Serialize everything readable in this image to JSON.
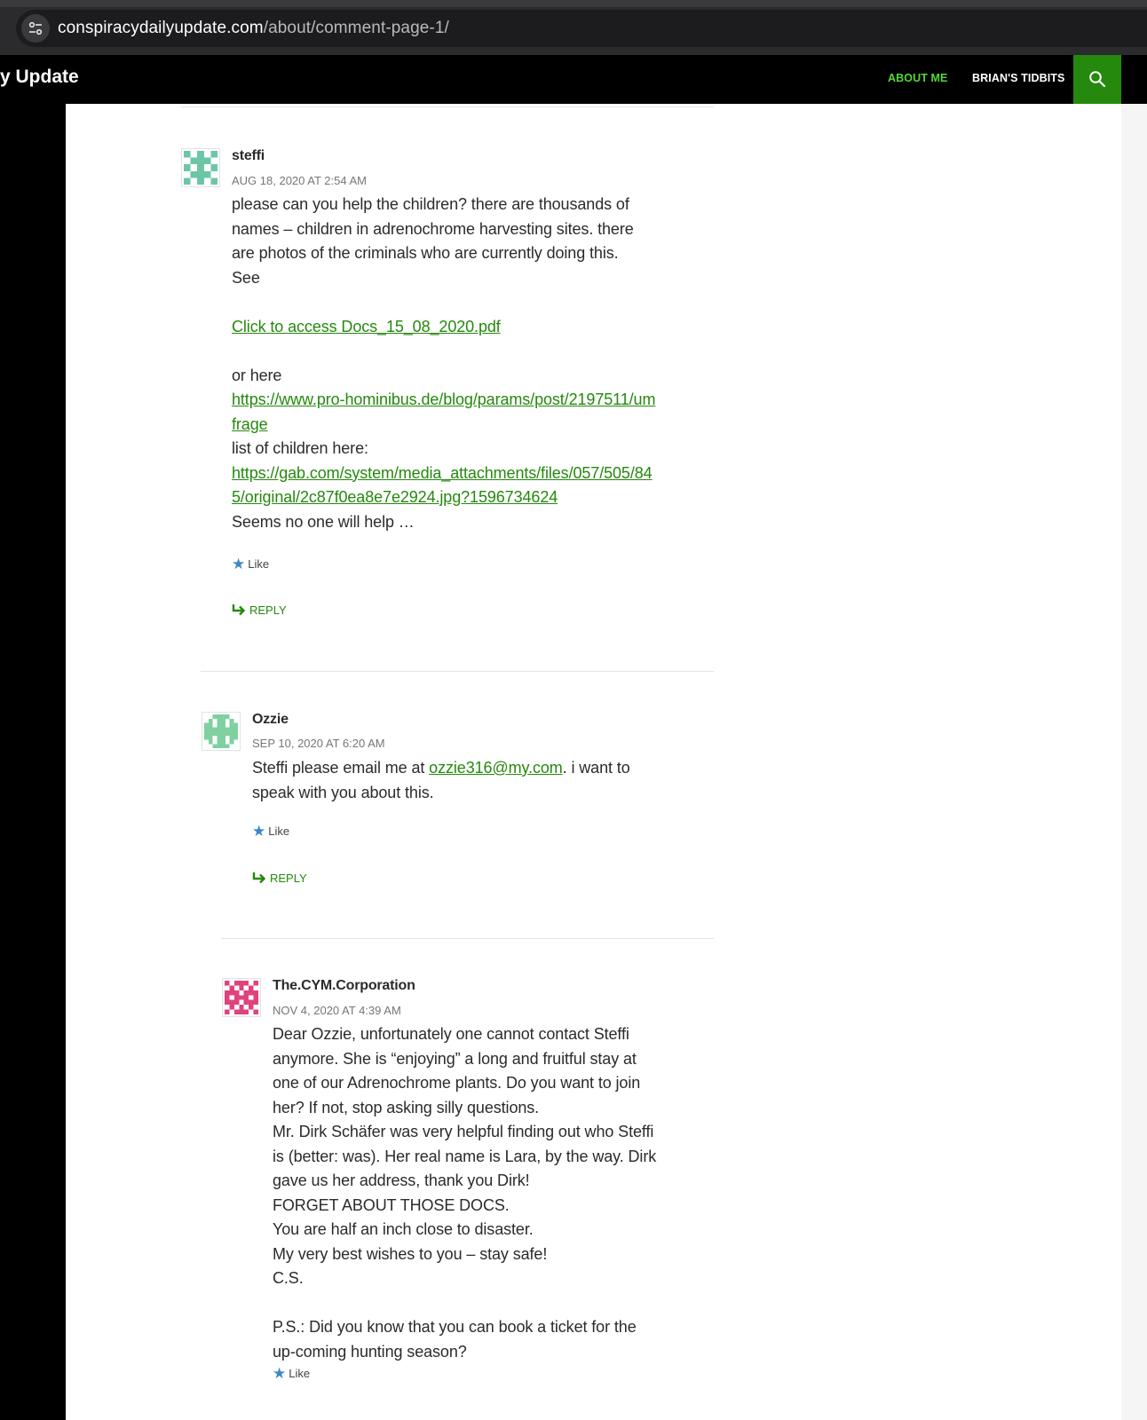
{
  "browser": {
    "url_host": "conspiracydailyupdate.com",
    "url_path": "/about/comment-page-1/"
  },
  "header": {
    "site_title": "y Update",
    "nav": [
      "ABOUT ME",
      "BRIAN'S TIDBITS"
    ]
  },
  "accent": "#24890d",
  "comments": [
    {
      "author": "steffi",
      "date": "AUG 18, 2020 AT 2:54 AM",
      "p1": "please can you help the children? there are thousands of names – children in adrenochrome harvesting sites. there are photos of the criminals who are currently doing this.",
      "p1b": "See",
      "link1": "Click to access Docs_15_08_2020.pdf",
      "p2": "or here",
      "link2": "https://www.pro-hominibus.de/blog/params/post/2197511/umfrage",
      "p3": "list of children here:",
      "link3": "https://gab.com/system/media_attachments/files/057/505/845/original/2c87f0ea8e7e2924.jpg?1596734624",
      "p4": "Seems no one will help …",
      "like": "Like",
      "reply": "REPLY"
    },
    {
      "author": "Ozzie",
      "date": "SEP 10, 2020 AT 6:20 AM",
      "pre": "Steffi please email me at ",
      "email": "ozzie316@my.com",
      "post": ". i want to speak with you about this.",
      "like": "Like",
      "reply": "REPLY"
    },
    {
      "author": "The.CYM.Corporation",
      "date": "NOV 4, 2020 AT 4:39 AM",
      "lines": [
        "Dear Ozzie, unfortunately one cannot contact Steffi anymore. She is “enjoying” a long and fruitful stay at one of our Adrenochrome plants. Do you want to join her? If not, stop asking silly questions.",
        "Mr. Dirk Schäfer was very helpful finding out who Steffi is (better: was). Her real name is Lara, by the way. Dirk gave us her address, thank you Dirk!",
        "FORGET ABOUT THOSE DOCS.",
        "You are half an inch close to disaster.",
        "My very best wishes to you – stay safe!",
        "C.S."
      ],
      "ps": "P.S.: Did you know that you can book a ticket for the up-coming hunting season?",
      "like": "Like"
    }
  ]
}
